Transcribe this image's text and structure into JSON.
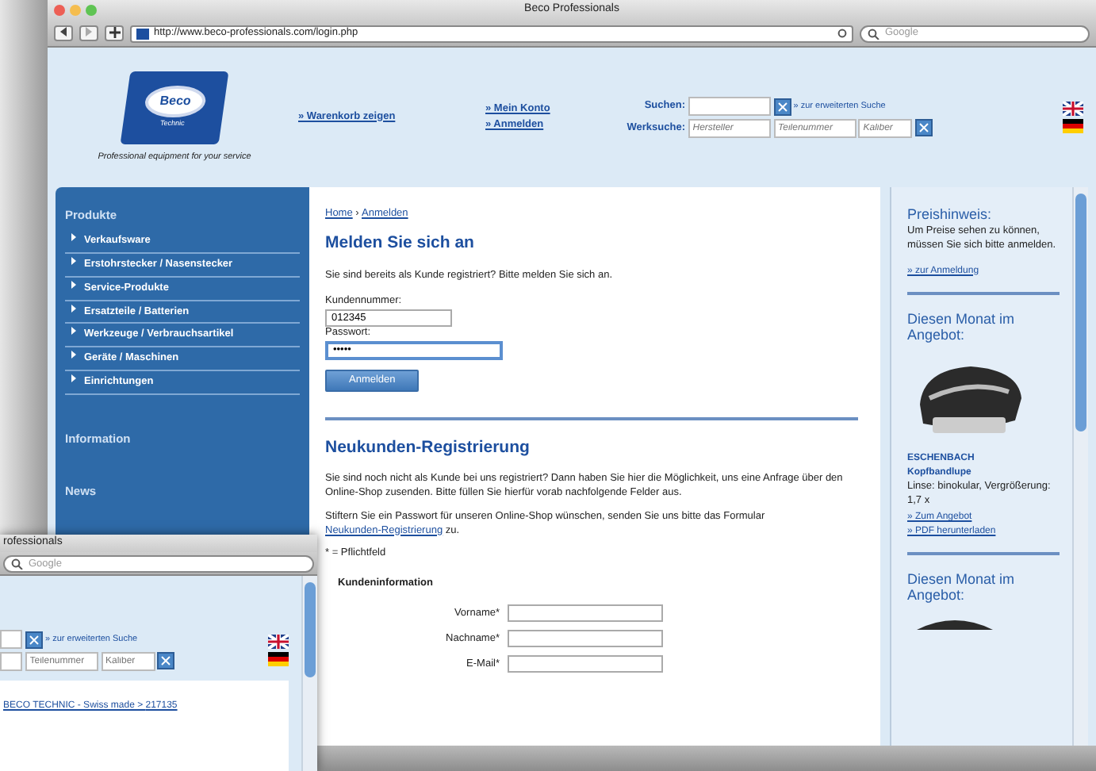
{
  "window": {
    "title": "Beco Professionals",
    "url": "http://www.beco-professionals.com/login.php",
    "search_placeholder": "Google"
  },
  "header": {
    "logo_text": "Beco",
    "logo_sub": "Technic",
    "tagline": "Professional equipment for your service",
    "cart_link": "» Warenkorb zeigen",
    "account_links": [
      "» Mein Konto",
      "» Anmelden"
    ],
    "search_label": "Suchen:",
    "search_more": "» zur erweiterten Suche",
    "parts_label": "Werksuche:",
    "parts_placeholders": [
      "Hersteller",
      "Teilenummer",
      "Kaliber"
    ]
  },
  "sidebar": {
    "heading": "Produkte",
    "items": [
      "Verkaufsware",
      "Erstohrstecker / Nasenstecker",
      "Service-Produkte",
      "Ersatzteile / Batterien",
      "Werkzeuge / Verbrauchsartikel",
      "Geräte / Maschinen",
      "Einrichtungen"
    ],
    "sections": [
      "Information",
      "News"
    ]
  },
  "main": {
    "breadcrumb": [
      "Home",
      "Anmelden"
    ],
    "breadcrumb_separator": "›",
    "login_title": "Melden Sie sich an",
    "login_intro": "Sie sind bereits als Kunde registriert? Bitte melden Sie sich an.",
    "customer_label": "Kundennummer:",
    "customer_value": "012345",
    "password_label": "Passwort:",
    "password_value": "•••••",
    "login_button": "Anmelden",
    "reg_title": "Neukunden-Registrierung",
    "reg_text": "Sie sind noch nicht als Kunde bei uns registriert? Dann haben Sie hier die Möglichkeit, uns eine Anfrage über den Online-Shop zusenden. Bitte füllen Sie hierfür vorab nachfolgende Felder aus.",
    "reg_text2": "Stiftern Sie ein Passwort für unseren Online-Shop wünschen, senden Sie uns bitte das Formular",
    "reg_link": "Neukunden-Registrierung",
    "reg_text2_end": "zu.",
    "required_note": "* = Pflichtfeld",
    "customer_info": "Kundeninformation",
    "fields": [
      "Vorname*",
      "Nachname*",
      "E-Mail*"
    ]
  },
  "right": {
    "price_title": "Preishinweis:",
    "price_text": "Um Preise sehen zu können, müssen Sie sich bitte anmelden.",
    "price_link": "» zur Anmeldung",
    "offers": [
      {
        "title": "Diesen Monat im Angebot:",
        "brand": "ESCHENBACH",
        "product": "Kopfbandlupe",
        "details": "Linse: binokular, Vergrößerung: 1,7 x",
        "links": [
          "» Zum Angebot",
          "» PDF herunterladen"
        ]
      },
      {
        "title": "Diesen Monat im Angebot:"
      }
    ]
  },
  "second_window": {
    "title": "rofessionals",
    "search_placeholder": "Google",
    "search_more": "» zur erweiterten Suche",
    "parts_placeholders": [
      "Teilenummer",
      "Kaliber"
    ],
    "breadcrumb": "BECO TECHNIC - Swiss made >",
    "breadcrumb_link": "217135"
  }
}
